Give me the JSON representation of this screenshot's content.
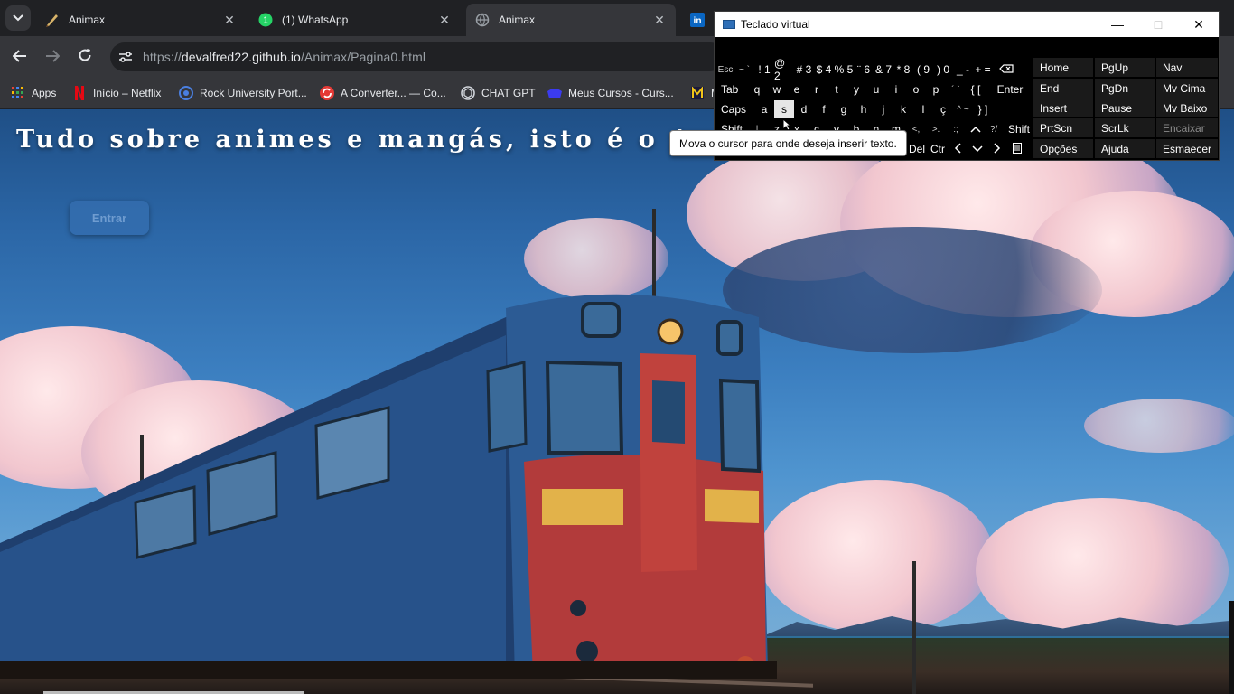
{
  "browser": {
    "tabs": [
      {
        "title": "Animax",
        "favicon": "animax-brush-icon",
        "active": false
      },
      {
        "title": "(1) WhatsApp",
        "favicon": "whatsapp-icon",
        "badge": "1",
        "active": false
      },
      {
        "title": "Animax",
        "favicon": "globe-icon",
        "active": true
      },
      {
        "title": "",
        "favicon": "linkedin-icon",
        "active": false
      }
    ],
    "url_prefix": "https://",
    "url_host": "devalfred22.github.io",
    "url_path": "/Animax/Pagina0.html",
    "bookmarks": [
      {
        "label": "Apps",
        "icon": "apps-grid-icon"
      },
      {
        "label": "Início – Netflix",
        "icon": "netflix-icon"
      },
      {
        "label": "Rock University Port...",
        "icon": "rock-university-icon"
      },
      {
        "label": "A Converter... — Co...",
        "icon": "converter-icon"
      },
      {
        "label": "CHAT GPT",
        "icon": "chatgpt-icon"
      },
      {
        "label": "Meus Cursos - Curs...",
        "icon": "courses-icon"
      },
      {
        "label": "M",
        "icon": "bookmark-m-icon"
      }
    ]
  },
  "page": {
    "hero_title": "Tudo sobre animes e mangás, isto é o Animax",
    "enter_label": "Entrar"
  },
  "osk": {
    "title": "Teclado virtual",
    "tooltip": "Mova o cursor para onde deseja inserir texto.",
    "row1": [
      "Esc",
      "~ `",
      "! 1",
      "@ 2",
      "# 3",
      "$ 4",
      "% 5",
      "¨ 6",
      "& 7",
      "* 8",
      "( 9",
      ") 0",
      "_ -",
      "+ ="
    ],
    "row2": [
      "Tab",
      "q",
      "w",
      "e",
      "r",
      "t",
      "y",
      "u",
      "i",
      "o",
      "p",
      "´ `",
      "{ [",
      "Enter"
    ],
    "row3": [
      "Caps",
      "a",
      "s",
      "d",
      "f",
      "g",
      "h",
      "j",
      "k",
      "l",
      "ç",
      "^ ~",
      "} ]"
    ],
    "row4": [
      "Shift",
      "|",
      "z",
      "x",
      "c",
      "v",
      "b",
      "n",
      "m",
      "<,",
      ">.",
      ":;",
      "?/",
      "Shift"
    ],
    "row5": [
      "Del",
      "Ctr"
    ],
    "nav_col1": [
      "Home",
      "End",
      "Insert",
      "PrtScn",
      "Opções"
    ],
    "nav_col2": [
      "PgUp",
      "PgDn",
      "Pause",
      "ScrLk",
      "Ajuda"
    ],
    "nav_col3": [
      "Nav",
      "Mv Cima",
      "Mv Baixo",
      "Encaixar",
      "Esmaecer"
    ]
  },
  "colors": {
    "chrome_dark": "#202124",
    "chrome_toolbar": "#35363a",
    "sky": "#2b66a6",
    "enter_button": "#346eaf"
  }
}
